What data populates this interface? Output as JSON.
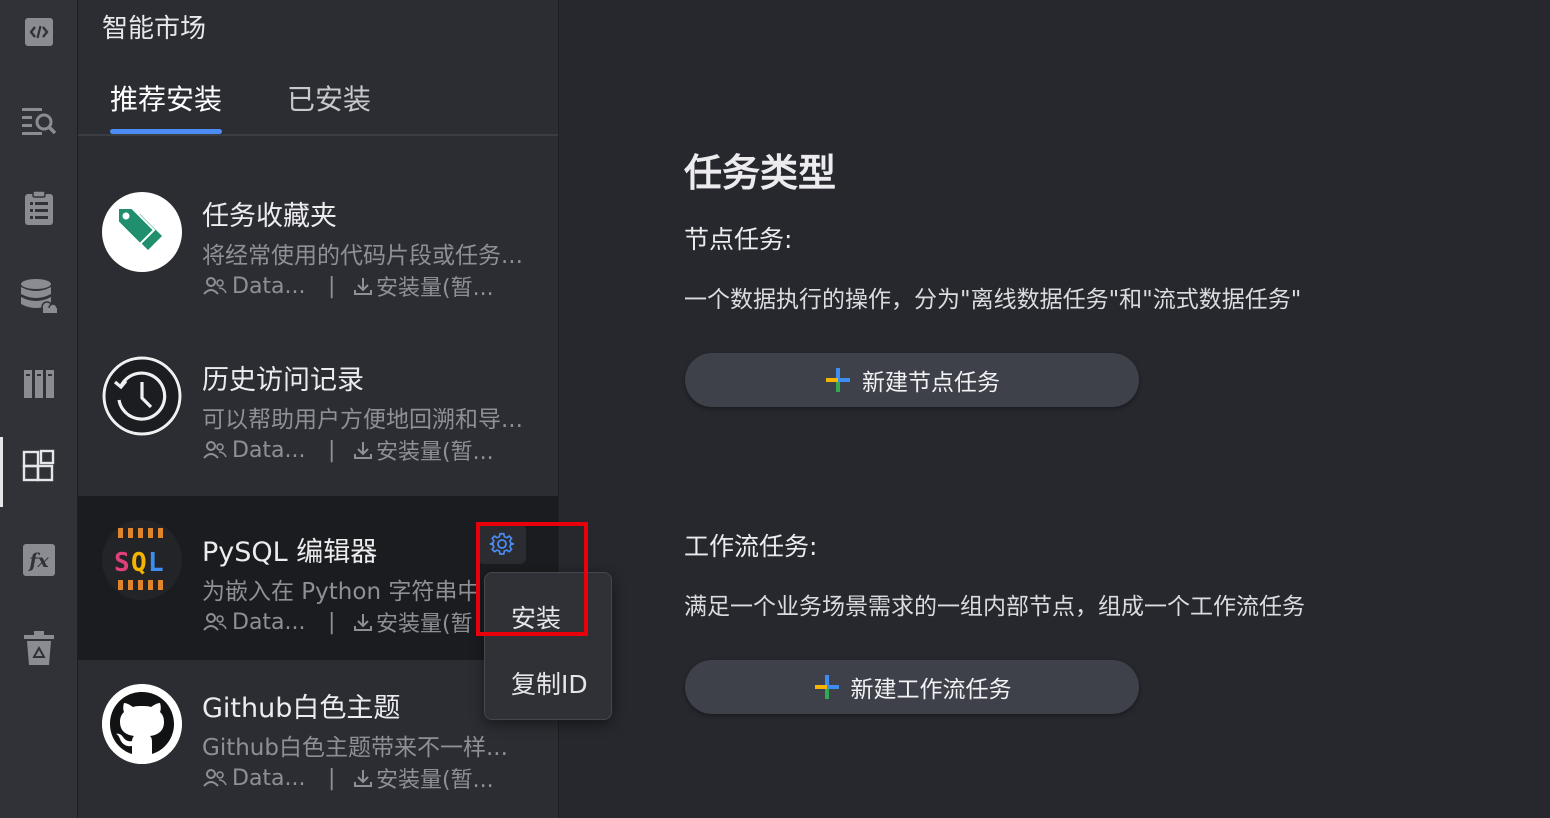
{
  "activity_bar": {
    "items": [
      {
        "icon": "code-icon"
      },
      {
        "icon": "search-list-icon"
      },
      {
        "icon": "clipboard-list-icon"
      },
      {
        "icon": "database-cloud-icon"
      },
      {
        "icon": "columns-icon"
      },
      {
        "icon": "extensions-icon",
        "active": true
      },
      {
        "icon": "function-fx-icon"
      },
      {
        "icon": "recycle-bin-icon"
      }
    ]
  },
  "panel": {
    "title": "智能市场",
    "tabs": [
      "推荐安装",
      "已安装"
    ],
    "active_tab": 0
  },
  "extensions": [
    {
      "name": "任务收藏夹",
      "description": "将经常使用的代码片段或任务...",
      "author": "Data...",
      "separator": "|",
      "downloads": "安装量(暂...",
      "icon": "tag-icon"
    },
    {
      "name": "历史访问记录",
      "description": "可以帮助用户方便地回溯和导...",
      "author": "Data...",
      "separator": "|",
      "downloads": "安装量(暂...",
      "icon": "history-clock-icon"
    },
    {
      "name": "PySQL 编辑器",
      "description": "为嵌入在 Python 字符串中",
      "author": "Data...",
      "separator": "|",
      "downloads": "安装量(暂",
      "icon": "sql-logo-icon",
      "selected": true
    },
    {
      "name": "Github白色主题",
      "description": "Github白色主题带来不一样...",
      "author": "Data...",
      "separator": "|",
      "downloads": "安装量(暂...",
      "icon": "github-icon"
    }
  ],
  "context_menu": {
    "items": [
      "安装",
      "复制ID"
    ]
  },
  "main": {
    "title": "任务类型",
    "sections": [
      {
        "heading": "节点任务:",
        "description": "一个数据执行的操作，分为\"离线数据任务\"和\"流式数据任务\"",
        "button_label": "新建节点任务"
      },
      {
        "heading": "工作流任务:",
        "description": "满足一个业务场景需求的一组内部节点，组成一个工作流任务",
        "button_label": "新建工作流任务"
      }
    ]
  },
  "colors": {
    "accent": "#4b8cf5",
    "highlight": "#e8000b",
    "tag_green": "#1f8f6d"
  }
}
